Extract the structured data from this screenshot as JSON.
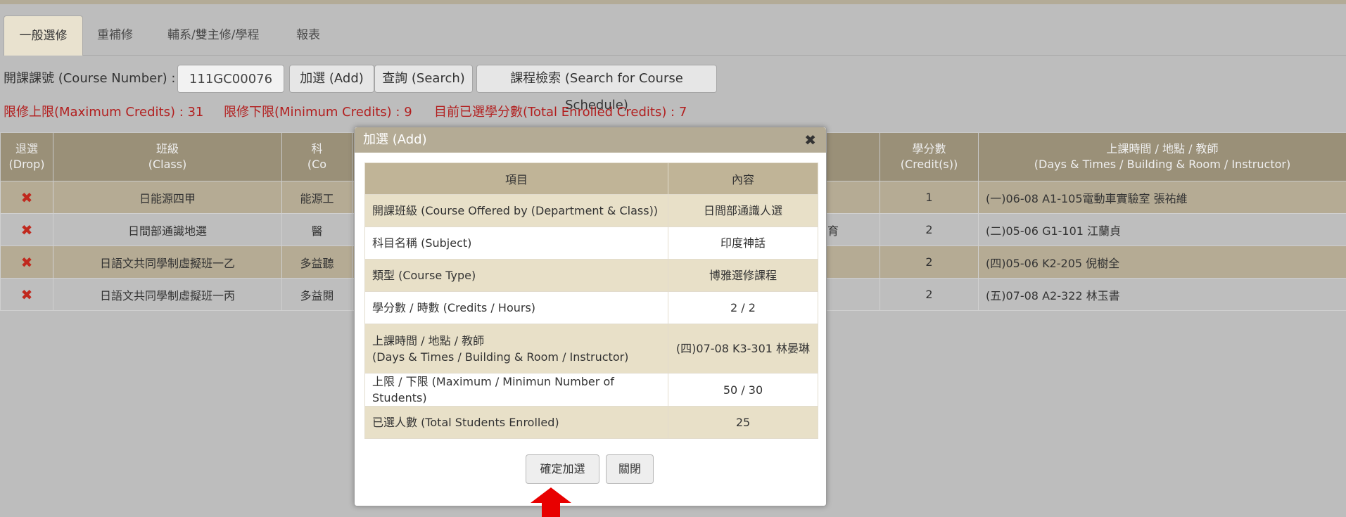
{
  "tabs": [
    {
      "label": "一般選修",
      "active": true
    },
    {
      "label": "重補修",
      "active": false
    },
    {
      "label": "輔系/雙主修/學程",
      "active": false
    },
    {
      "label": "報表",
      "active": false
    }
  ],
  "course_entry": {
    "label": "開課課號 (Course Number) :",
    "value": "111GC00076",
    "add_label": "加選 (Add)",
    "search_label": "查詢 (Search)",
    "schedule_label": "課程檢索 (Search for Course Schedule)"
  },
  "credits": {
    "max": "限修上限(Maximum Credits) : 31",
    "min": "限修下限(Minimum Credits) : 9",
    "total": "目前已選學分數(Total Enrolled Credits) : 7"
  },
  "enrolled_table": {
    "headers": {
      "drop": "退選",
      "drop_en": "(Drop)",
      "class": "班級",
      "class_en": "(Class)",
      "course": "科",
      "course_en": "(Co",
      "credits": "學分數",
      "credits_en": "(Credit(s))",
      "schedule": "上課時間 / 地點 / 教師",
      "schedule_en": "(Days & Times / Building & Room / Instructor)"
    },
    "rows": [
      {
        "drop": "✖",
        "class": "日能源四甲",
        "course": "能源工",
        "type": "",
        "credits": "1",
        "schedule": "(一)06-08 A1-105電動車實驗室 張祐維"
      },
      {
        "drop": "✖",
        "class": "日間部通識地選",
        "course": "醫",
        "type": "育",
        "credits": "2",
        "schedule": "(二)05-06 G1-101 江蘭貞"
      },
      {
        "drop": "✖",
        "class": "日語文共同學制虛擬班一乙",
        "course": "多益聽",
        "type": "",
        "credits": "2",
        "schedule": "(四)05-06 K2-205 倪樹全"
      },
      {
        "drop": "✖",
        "class": "日語文共同學制虛擬班一丙",
        "course": "多益閱",
        "type": "",
        "credits": "2",
        "schedule": "(五)07-08 A2-322 林玉書"
      }
    ]
  },
  "modal": {
    "title": "加選 (Add)",
    "close": "✖",
    "headers": {
      "item": "項目",
      "content": "內容"
    },
    "rows": [
      {
        "item": "開課班級 (Course Offered by (Department & Class))",
        "value": "日間部通識人選"
      },
      {
        "item": "科目名稱 (Subject)",
        "value": "印度神話"
      },
      {
        "item": "類型 (Course Type)",
        "value": "博雅選修課程"
      },
      {
        "item": "學分數 / 時數 (Credits / Hours)",
        "value": "2 / 2"
      },
      {
        "item": "上課時間 / 地點 / 教師",
        "item2": "(Days & Times / Building & Room / Instructor)",
        "value": "(四)07-08 K3-301 林晏琳"
      },
      {
        "item": "上限 / 下限 (Maximum / Minimun Number of Students)",
        "value": "50 / 30"
      },
      {
        "item": "已選人數 (Total Students Enrolled)",
        "value": "25"
      }
    ],
    "confirm_label": "確定加選",
    "close_label": "關閉"
  },
  "colors": {
    "accent": "#b4ab95",
    "warning": "#b21f1f",
    "arrow": "#e80000"
  }
}
